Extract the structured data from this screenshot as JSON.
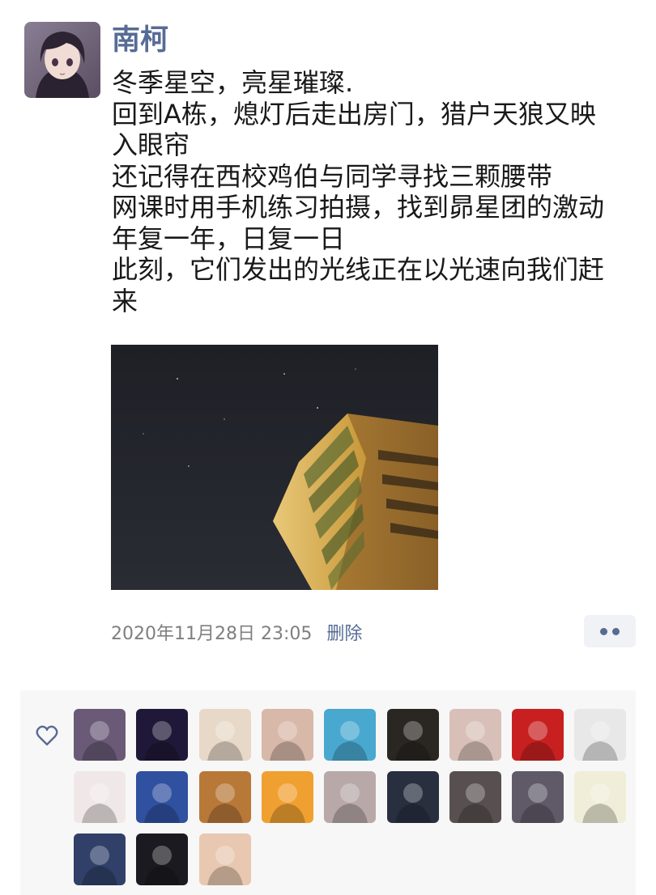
{
  "post": {
    "author": "南柯",
    "text_lines": [
      "冬季星空，亮星璀璨.",
      "回到A栋，熄灯后走出房门，猎户天狼又映",
      "入眼帘",
      "还记得在西校鸡伯与同学寻找三颗腰带",
      "网课时用手机练习拍摄，找到昴星团的激动",
      "年复一年，日复一日",
      "此刻，它们发出的光线正在以光速向我们赶",
      "来"
    ],
    "timestamp": "2020年11月28日 23:05",
    "delete_label": "删除",
    "avatar_icon": "anime-girl-avatar",
    "photo_icon": "night-sky-building-photo"
  },
  "actions": {
    "more_icon": "more-dots-icon"
  },
  "likes": {
    "icon": "heart-outline-icon",
    "count": 21,
    "avatars": [
      {
        "icon": "anime-girl-avatar",
        "color": "#6a5a78"
      },
      {
        "icon": "night-city-avatar",
        "color": "#201838"
      },
      {
        "icon": "anime-sketch-avatar",
        "color": "#e8d8c8"
      },
      {
        "icon": "cartoon-green-avatar",
        "color": "#d8b8a8"
      },
      {
        "icon": "blue-eye-avatar",
        "color": "#48a8d0"
      },
      {
        "icon": "dark-portrait-avatar",
        "color": "#2a2622"
      },
      {
        "icon": "teal-heart-avatar",
        "color": "#d8c0b8"
      },
      {
        "icon": "red-orb-avatar",
        "color": "#c82020"
      },
      {
        "icon": "manga-sketch-avatar",
        "color": "#e8e8e8"
      },
      {
        "icon": "soccer-player-avatar",
        "color": "#f0e8e8"
      },
      {
        "icon": "soccer-team-avatar",
        "color": "#3050a0"
      },
      {
        "icon": "dog-avatar",
        "color": "#b87838"
      },
      {
        "icon": "lion-cartoon-avatar",
        "color": "#f0a030"
      },
      {
        "icon": "girl-cat-avatar",
        "color": "#b8a8a8"
      },
      {
        "icon": "young-man-avatar",
        "color": "#283040"
      },
      {
        "icon": "footballer-avatar",
        "color": "#585050"
      },
      {
        "icon": "anime-boy-avatar",
        "color": "#605a68"
      },
      {
        "icon": "avicii-logo-avatar",
        "color": "#f0eed8"
      },
      {
        "icon": "anime-short-hair-avatar",
        "color": "#304068"
      },
      {
        "icon": "dark-helmet-avatar",
        "color": "#1a1a20"
      },
      {
        "icon": "anime-boy-hand-avatar",
        "color": "#e8c8b0"
      }
    ]
  },
  "colors": {
    "link": "#576b95",
    "text": "#191919",
    "muted": "#7f7f7f",
    "panel": "#f7f7f7"
  }
}
